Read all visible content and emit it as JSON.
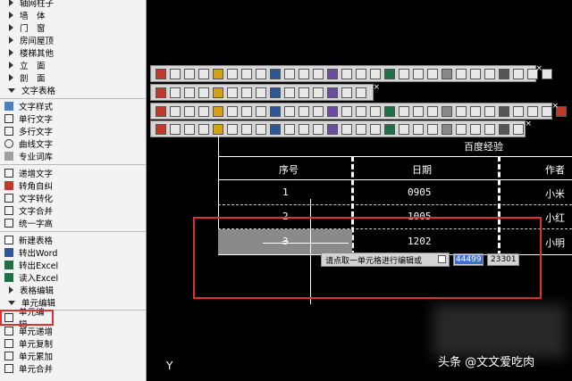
{
  "menu": {
    "top_items": [
      "轴网柱子",
      "墙　体",
      "门　窗",
      "房间屋顶",
      "楼梯其他",
      "立　面",
      "剖　面"
    ],
    "expanded": "文字表格",
    "items": [
      "文字样式",
      "单行文字",
      "多行文字",
      "曲线文字",
      "专业词库",
      "递增文字",
      "转角自纠",
      "文字转化",
      "文字合并",
      "统一字高",
      "新建表格",
      "转出Word",
      "转出Excel",
      "读入Excel",
      "表格编辑",
      "单元编辑",
      "单元递增",
      "单元复制",
      "单元累加",
      "单元合并"
    ],
    "expanded_index": 14,
    "highlighted": "单元编辑"
  },
  "table": {
    "title": "百度经验",
    "headers": [
      "序号",
      "日期",
      "作者"
    ],
    "rows": [
      {
        "num": "1",
        "date": "0905",
        "author": "小米"
      },
      {
        "num": "2",
        "date": "1005",
        "author": "小红"
      },
      {
        "num": "3",
        "date": "1202",
        "author": "小明"
      }
    ]
  },
  "prompt": {
    "text": "请点取一单元格进行编辑或",
    "coord_x": "44499",
    "coord_y": "23301"
  },
  "cursor_glyph": "Y",
  "watermark": "头条 @文文爱吃肉",
  "colors": {
    "highlight": "#e23030",
    "background": "#000000",
    "coord_selected": "#3b6fd6"
  }
}
